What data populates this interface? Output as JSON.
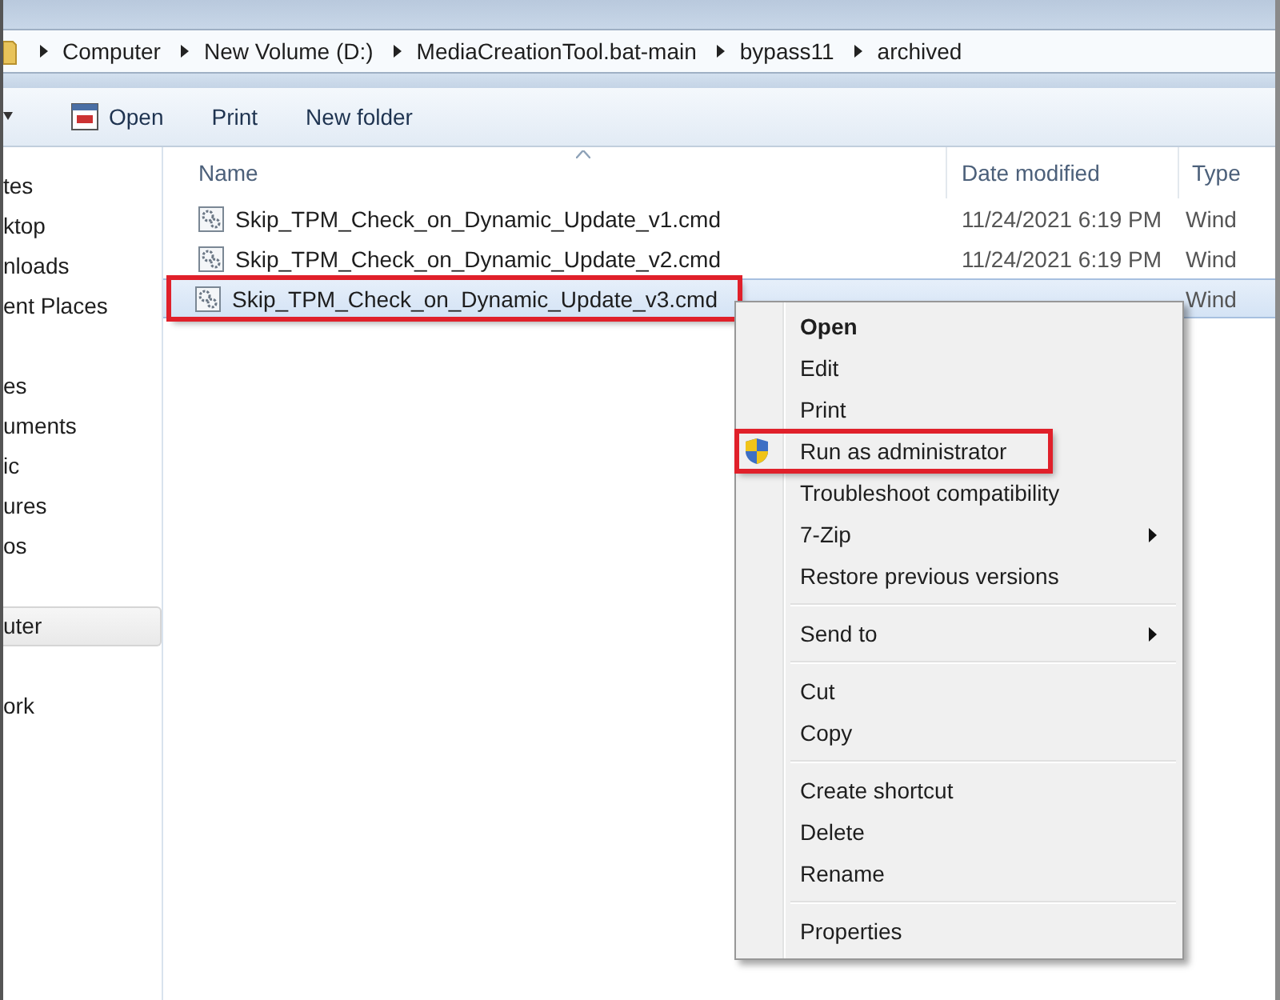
{
  "address_bar": {
    "crumbs": [
      "Computer",
      "New Volume (D:)",
      "MediaCreationTool.bat-main",
      "bypass11",
      "archived"
    ]
  },
  "toolbar": {
    "buttons": [
      {
        "label": "Open",
        "kind": "icon"
      },
      {
        "label": "Print",
        "kind": "text"
      },
      {
        "label": "New folder",
        "kind": "text"
      }
    ]
  },
  "sidebar": {
    "groups": [
      {
        "items": [
          {
            "label": "tes",
            "selected": false
          },
          {
            "label": "ktop",
            "selected": false
          },
          {
            "label": "nloads",
            "selected": false
          },
          {
            "label": "ent Places",
            "selected": false
          }
        ]
      },
      {
        "items": [
          {
            "label": "es",
            "selected": false
          },
          {
            "label": "uments",
            "selected": false
          },
          {
            "label": "ic",
            "selected": false
          },
          {
            "label": "ures",
            "selected": false
          },
          {
            "label": "os",
            "selected": false
          }
        ]
      },
      {
        "items": [
          {
            "label": "uter",
            "selected": true
          }
        ]
      },
      {
        "items": [
          {
            "label": "ork",
            "selected": false
          }
        ]
      }
    ]
  },
  "table": {
    "columns": [
      "Name",
      "Date modified",
      "Type"
    ],
    "rows": [
      {
        "name": "Skip_TPM_Check_on_Dynamic_Update_v1.cmd",
        "date": "11/24/2021 6:19 PM",
        "type": "Wind",
        "selected": false,
        "highlighted": false
      },
      {
        "name": "Skip_TPM_Check_on_Dynamic_Update_v2.cmd",
        "date": "11/24/2021 6:19 PM",
        "type": "Wind",
        "selected": false,
        "highlighted": false
      },
      {
        "name": "Skip_TPM_Check_on_Dynamic_Update_v3.cmd",
        "type": "Wind",
        "selected": true,
        "highlighted": true
      }
    ]
  },
  "context_menu": {
    "items": [
      {
        "kind": "item",
        "label": "Open",
        "default": true,
        "submenu": false,
        "highlighted": false
      },
      {
        "kind": "item",
        "label": "Edit",
        "default": false,
        "submenu": false,
        "highlighted": false
      },
      {
        "kind": "item",
        "label": "Print",
        "default": false,
        "submenu": false,
        "highlighted": false
      },
      {
        "kind": "shield",
        "label": "Run as administrator",
        "default": false,
        "submenu": false,
        "highlighted": true
      },
      {
        "kind": "item",
        "label": "Troubleshoot compatibility",
        "default": false,
        "submenu": false,
        "highlighted": false
      },
      {
        "kind": "item",
        "label": "7-Zip",
        "default": false,
        "submenu": true,
        "highlighted": false
      },
      {
        "kind": "item",
        "label": "Restore previous versions",
        "default": false,
        "submenu": false,
        "highlighted": false
      },
      {
        "kind": "separator"
      },
      {
        "kind": "item",
        "label": "Send to",
        "default": false,
        "submenu": true,
        "highlighted": false
      },
      {
        "kind": "separator"
      },
      {
        "kind": "item",
        "label": "Cut",
        "default": false,
        "submenu": false,
        "highlighted": false
      },
      {
        "kind": "item",
        "label": "Copy",
        "default": false,
        "submenu": false,
        "highlighted": false
      },
      {
        "kind": "separator"
      },
      {
        "kind": "item",
        "label": "Create shortcut",
        "default": false,
        "submenu": false,
        "highlighted": false
      },
      {
        "kind": "item",
        "label": "Delete",
        "default": false,
        "submenu": false,
        "highlighted": false
      },
      {
        "kind": "item",
        "label": "Rename",
        "default": false,
        "submenu": false,
        "highlighted": false
      },
      {
        "kind": "separator"
      },
      {
        "kind": "item",
        "label": "Properties",
        "default": false,
        "submenu": false,
        "highlighted": false
      }
    ]
  }
}
